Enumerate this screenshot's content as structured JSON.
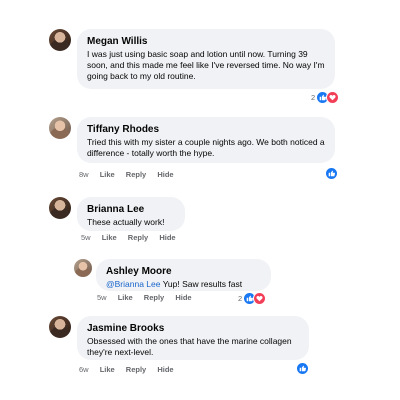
{
  "comments": [
    {
      "author": "Megan Willis",
      "text": "I was just using basic soap and lotion until now. Turning 39 soon, and this made me feel like I've reversed time. No way I'm going back to my old routine.",
      "reactions": {
        "count": "2",
        "icons": [
          "like-icon",
          "love-icon"
        ]
      }
    },
    {
      "author": "Tiffany Rhodes",
      "text": "Tried this with my sister a couple nights ago. We both noticed a difference - totally worth the hype.",
      "actions": {
        "time": "8w",
        "like": "Like",
        "reply": "Reply",
        "hide": "Hide"
      },
      "reactions": {
        "icons": [
          "like-icon"
        ]
      }
    },
    {
      "author": "Brianna Lee",
      "text": "These actually work!",
      "actions": {
        "time": "5w",
        "like": "Like",
        "reply": "Reply",
        "hide": "Hide"
      }
    },
    {
      "author": "Ashley Moore",
      "mention": "@Brianna Lee",
      "text": " Yup! Saw results fast",
      "actions": {
        "time": "5w",
        "like": "Like",
        "reply": "Reply",
        "hide": "Hide"
      },
      "reactions": {
        "count": "2",
        "icons": [
          "like-icon",
          "love-icon"
        ]
      }
    },
    {
      "author": "Jasmine Brooks",
      "text": "Obsessed with the ones that have the marine collagen they're next-level.",
      "actions": {
        "time": "6w",
        "like": "Like",
        "reply": "Reply",
        "hide": "Hide"
      },
      "reactions": {
        "icons": [
          "like-icon"
        ]
      }
    }
  ],
  "colors": {
    "bubble": "#f0f2f5",
    "like": "#1877f2",
    "love": "#f33e58",
    "mention": "#1a66cc",
    "meta": "#65676b"
  }
}
